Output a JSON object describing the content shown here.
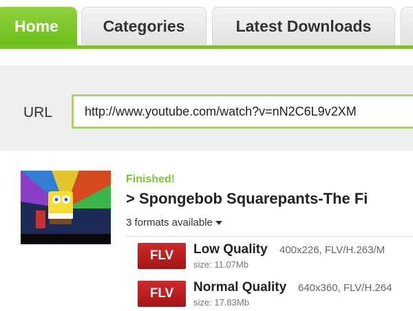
{
  "tabs": [
    {
      "label": "Home",
      "active": true
    },
    {
      "label": "Categories",
      "active": false
    },
    {
      "label": "Latest Downloads",
      "active": false
    }
  ],
  "url_form": {
    "label": "URL",
    "value": "http://www.youtube.com/watch?v=nN2C6L9v2XM"
  },
  "result": {
    "status": "Finished!",
    "title": "> Spongebob Squarepants-The Fi",
    "formats_label": "3 formats available",
    "formats": [
      {
        "badge": "FLV",
        "quality": "Low Quality",
        "detail": "400x226, FLV/H.263/M",
        "size": "size: 11.07Mb"
      },
      {
        "badge": "FLV",
        "quality": "Normal Quality",
        "detail": "640x360, FLV/H.264",
        "size": "size: 17.83Mb"
      }
    ]
  },
  "colors": {
    "accent_green": "#78c425",
    "badge_red": "#c02020",
    "status_green": "#7cc431"
  }
}
